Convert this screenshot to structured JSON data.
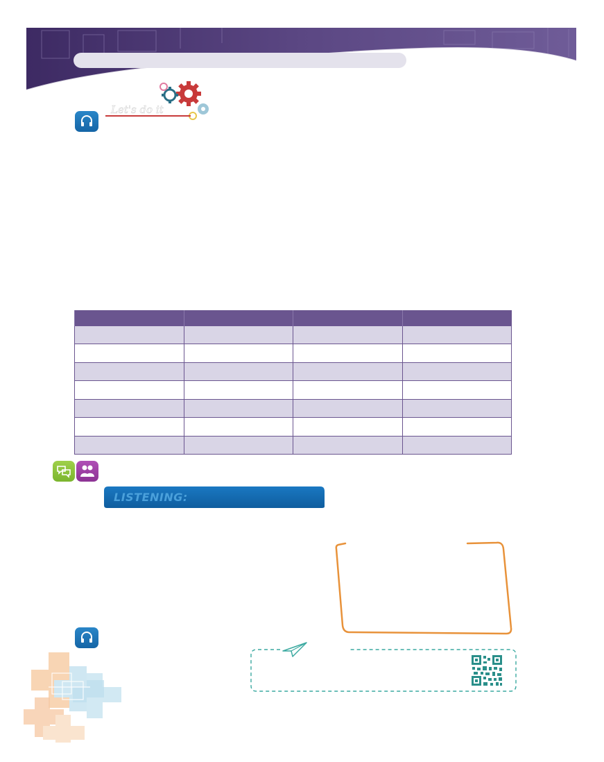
{
  "section_titles": {
    "activity_banner": "Let's do it",
    "listening_banner": "LISTENING:"
  },
  "icons": {
    "listening_icon_top": "headphones-icon",
    "speaking_icon": "speech-bubble-icon",
    "pair_work_icon": "pair-work-icon",
    "listening_icon_bottom": "headphones-icon",
    "paper_plane_icon": "paper-plane-icon",
    "qr_code": "qr-code-icon"
  },
  "table": {
    "columns": [
      "",
      "",
      "",
      ""
    ],
    "rows": [
      [
        "",
        "",
        "",
        ""
      ],
      [
        "",
        "",
        "",
        ""
      ],
      [
        "",
        "",
        "",
        ""
      ],
      [
        "",
        "",
        "",
        ""
      ],
      [
        "",
        "",
        "",
        ""
      ],
      [
        "",
        "",
        "",
        ""
      ],
      [
        "",
        "",
        "",
        ""
      ]
    ]
  },
  "colors": {
    "header_purple": "#5a4680",
    "table_header": "#6a558f",
    "table_shade": "#d9d5e6",
    "listening_blue": "#1a6fb5",
    "note_orange": "#e8923a",
    "info_teal": "#3aa9a0"
  }
}
